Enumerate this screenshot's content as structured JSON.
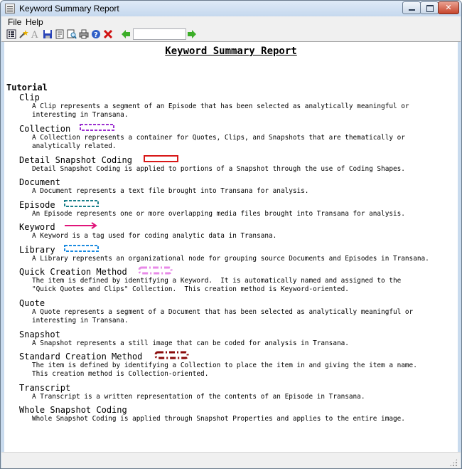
{
  "window": {
    "title": "Keyword Summary Report"
  },
  "menu": {
    "file_label": "File",
    "help_label": "Help"
  },
  "toolbar": {
    "nav_input_value": ""
  },
  "report": {
    "title": "Keyword Summary Report",
    "section": "Tutorial",
    "keywords": [
      {
        "name": "Clip",
        "def_1": "A Clip represents a segment of an Episode that has been selected as analytically meaningful or",
        "def_2": "interesting in Transana."
      },
      {
        "name": "Collection",
        "def_1": "A Collection represents a container for Quotes, Clips, and Snapshots that are thematically or",
        "def_2": "analytically related.",
        "swatch_color": "#9b30d0",
        "swatch_style": "dashed box"
      },
      {
        "name": "Detail Snapshot Coding",
        "def_1": "Detail Snapshot Coding is applied to portions of a Snapshot through the use of Coding Shapes.",
        "swatch_color": "#d81818",
        "swatch_style": "solid box"
      },
      {
        "name": "Document",
        "def_1": "A Document represents a text file brought into Transana for analysis."
      },
      {
        "name": "Episode",
        "def_1": "An Episode represents one or more overlapping media files brought into Transana for analysis.",
        "swatch_color": "#1a7f8a",
        "swatch_style": "dashed box"
      },
      {
        "name": "Keyword",
        "def_1": "A Keyword is a tag used for coding analytic data in Transana.",
        "swatch_color": "#e0157a",
        "swatch_style": "arrow"
      },
      {
        "name": "Library",
        "def_1": "A Library represents an organizational node for grouping source Documents and Episodes in Transana.",
        "swatch_color": "#1a8ae0",
        "swatch_style": "dashed box"
      },
      {
        "name": "Quick Creation Method",
        "def_1": "The item is defined by identifying a Keyword.  It is automatically named and assigned to the",
        "def_2": "\"Quick Quotes and Clips\" Collection.  This creation method is Keyword-oriented.",
        "swatch_color": "#e88ae8",
        "swatch_style": "dash-dot box"
      },
      {
        "name": "Quote",
        "def_1": "A Quote represents a segment of a Document that has been selected as analytically meaningful or",
        "def_2": "interesting in Transana."
      },
      {
        "name": "Snapshot",
        "def_1": "A Snapshot represents a still image that can be coded for analysis in Transana."
      },
      {
        "name": "Standard Creation Method",
        "def_1": "The item is defined by identifying a Collection to place the item in and giving the item a name.",
        "def_2": "This creation method is Collection-oriented.",
        "swatch_color": "#8a0a0a",
        "swatch_style": "dash-dot box"
      },
      {
        "name": "Transcript",
        "def_1": "A Transcript is a written representation of the contents of an Episode in Transana."
      },
      {
        "name": "Whole Snapshot Coding",
        "def_1": "Whole Snapshot Coding is applied through Snapshot Properties and applies to the entire image."
      }
    ]
  },
  "icons": [
    "list-icon",
    "wand-icon",
    "font-icon",
    "save-icon",
    "page-setup-icon",
    "print-preview-icon",
    "print-icon",
    "help-icon",
    "close-report-icon",
    "back-arrow-icon",
    "forward-arrow-icon"
  ]
}
